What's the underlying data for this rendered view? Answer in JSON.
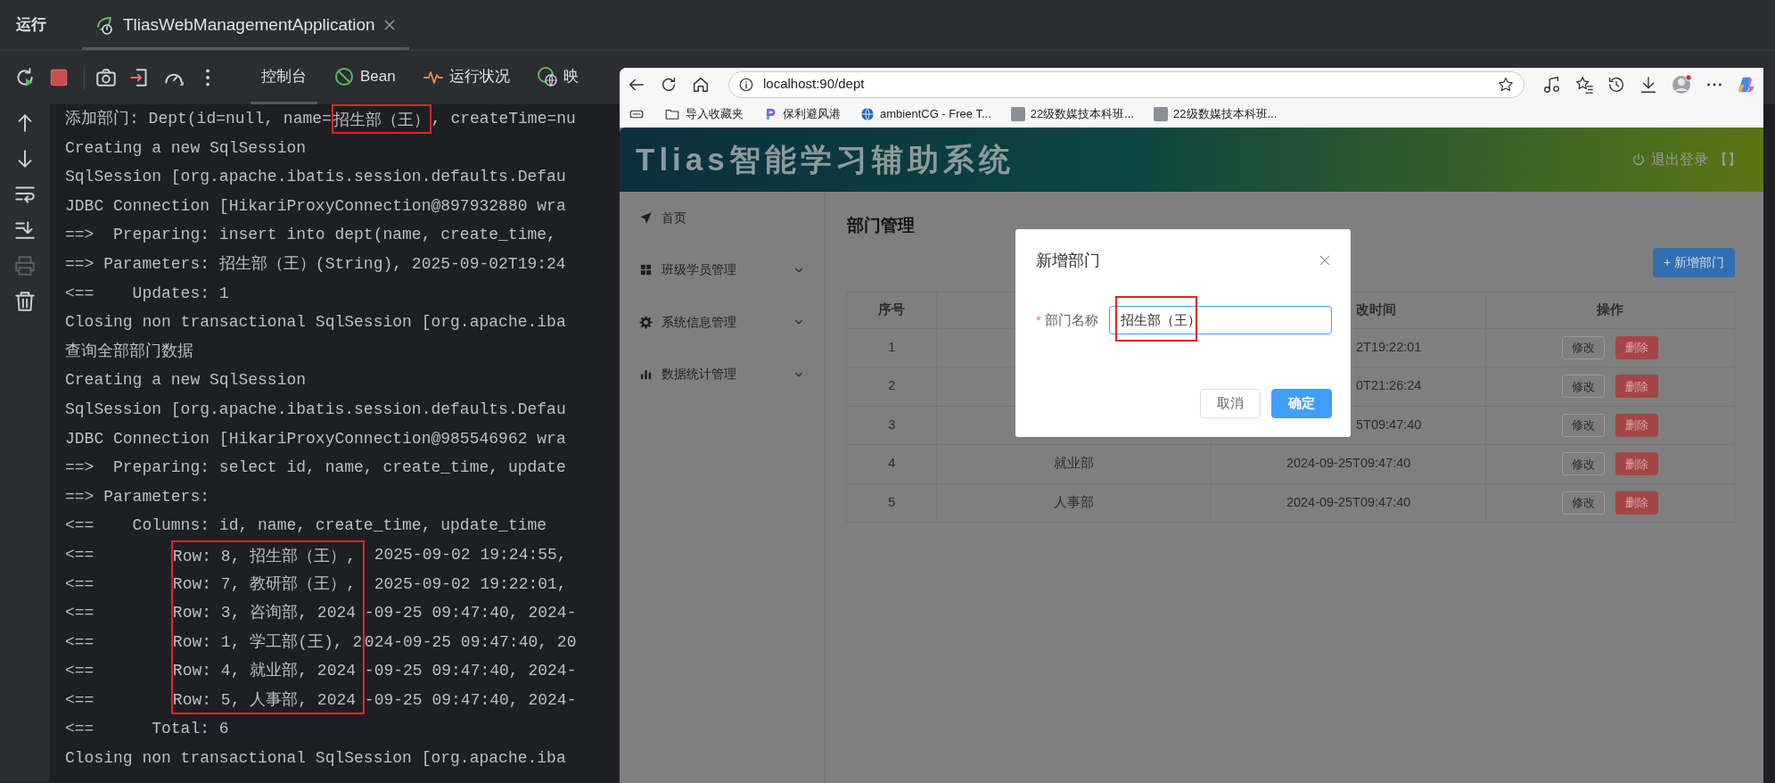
{
  "ide": {
    "title": "运行",
    "run_tab": {
      "label": "TliasWebManagementApplication",
      "selected": true
    },
    "tool_tabs": [
      {
        "label": "控制台",
        "selected": true
      },
      {
        "label": "Bean",
        "selected": false
      },
      {
        "label": "运行状况",
        "selected": false
      },
      {
        "label": "映",
        "selected": false
      }
    ],
    "gutter": [
      {
        "kind": "up",
        "disabled": false
      },
      {
        "kind": "down",
        "disabled": false
      },
      {
        "kind": "wrap",
        "disabled": false
      },
      {
        "kind": "scroll",
        "disabled": false
      },
      {
        "kind": "print",
        "disabled": true
      },
      {
        "kind": "trash",
        "disabled": false
      }
    ],
    "console": {
      "lines": [
        {
          "parts": [
            {
              "text": "添加部门: Dept(id=null, name=",
              "boxed": false
            },
            {
              "text": "招生部（王）",
              "boxed": true
            },
            {
              "text": ", createTime=nu",
              "boxed": false
            }
          ]
        },
        {
          "text": "Creating a new SqlSession"
        },
        {
          "text": "SqlSession [org.apache.ibatis.session.defaults.Defau"
        },
        {
          "text": "JDBC Connection [HikariProxyConnection@897932880 wra"
        },
        {
          "text": "==>  Preparing: insert into dept(name, create_time,"
        },
        {
          "text": "==> Parameters: 招生部（王）(String), 2025-09-02T19:24"
        },
        {
          "text": "<==    Updates: 1"
        },
        {
          "text": "Closing non transactional SqlSession [org.apache.iba"
        },
        {
          "text": "查询全部部门数据"
        },
        {
          "text": "Creating a new SqlSession"
        },
        {
          "text": "SqlSession [org.apache.ibatis.session.defaults.Defau"
        },
        {
          "text": "JDBC Connection [HikariProxyConnection@985546962 wra"
        },
        {
          "text": "==>  Preparing: select id, name, create_time, update"
        },
        {
          "text": "==> Parameters:"
        },
        {
          "text": "<==    Columns: id, name, create_time, update_time"
        },
        {
          "parts": [
            {
              "text": "<==        ",
              "boxed": false
            },
            {
              "text": "Row: 8, 招生部（王）,",
              "boxed": true
            },
            {
              "text": " 2025-09-02 19:24:55,",
              "boxed": false
            }
          ]
        },
        {
          "parts": [
            {
              "text": "<==        ",
              "boxed": false
            },
            {
              "text": "Row: 7, 教研部（王）,",
              "boxed": true
            },
            {
              "text": " 2025-09-02 19:22:01,",
              "boxed": false
            }
          ]
        },
        {
          "parts": [
            {
              "text": "<==        ",
              "boxed": false
            },
            {
              "text": "Row: 3, 咨询部, 2024",
              "boxed": true
            },
            {
              "text": "-09-25 09:47:40, 2024-",
              "boxed": false
            }
          ]
        },
        {
          "parts": [
            {
              "text": "<==        ",
              "boxed": false
            },
            {
              "text": "Row: 1, 学工部(王), 2",
              "boxed": true
            },
            {
              "text": "024-09-25 09:47:40, 20",
              "boxed": false
            }
          ]
        },
        {
          "parts": [
            {
              "text": "<==        ",
              "boxed": false
            },
            {
              "text": "Row: 4, 就业部, 2024",
              "boxed": true
            },
            {
              "text": "-09-25 09:47:40, 2024-",
              "boxed": false
            }
          ]
        },
        {
          "parts": [
            {
              "text": "<==        ",
              "boxed": false
            },
            {
              "text": "Row: 5, 人事部, 2024",
              "boxed": true
            },
            {
              "text": "-09-25 09:47:40, 2024-",
              "boxed": false
            }
          ]
        },
        {
          "text": "<==      Total: 6"
        },
        {
          "text": "Closing non transactional SqlSession [org.apache.iba"
        }
      ]
    }
  },
  "browser": {
    "address": "localhost:90/dept",
    "profile_notification": true,
    "bookmarks": [
      {
        "kind": "folder",
        "label": "导入收藏夹"
      },
      {
        "kind": "brand",
        "label": "保利避风港"
      },
      {
        "kind": "globe",
        "label": "ambientCG - Free T..."
      },
      {
        "kind": "photo",
        "label": "22级数媒技本科班..."
      },
      {
        "kind": "photo",
        "label": "22级数媒技本科班..."
      }
    ]
  },
  "app": {
    "title": "Tlias智能学习辅助系统",
    "logout": "退出登录",
    "logout_extra": "【】",
    "menu": [
      {
        "label": "首页",
        "kind": "link"
      },
      {
        "label": "班级学员管理",
        "kind": "submenu",
        "expanded": false
      },
      {
        "label": "系统信息管理",
        "kind": "submenu",
        "expanded": false
      },
      {
        "label": "数据统计管理",
        "kind": "submenu",
        "expanded": false
      }
    ],
    "page_title": "部门管理",
    "add_button": "+ 新增部门",
    "table": {
      "columns": {
        "number": "序号",
        "time": "改时间",
        "actions": "操作"
      },
      "rows": [
        {
          "number": "1",
          "time": "2T19:22:01",
          "edit": "修改",
          "delete": "删除"
        },
        {
          "number": "2",
          "time": "0T21:26:24",
          "edit": "修改",
          "delete": "删除"
        },
        {
          "number": "3",
          "time": "5T09:47:40",
          "edit": "修改",
          "delete": "删除"
        },
        {
          "number": "4",
          "name": "就业部",
          "time": "2024-09-25T09:47:40",
          "edit": "修改",
          "delete": "删除"
        },
        {
          "number": "5",
          "name": "人事部",
          "time": "2024-09-25T09:47:40",
          "edit": "修改",
          "delete": "删除"
        }
      ]
    },
    "dialog": {
      "title": "新增部门",
      "field": {
        "label": "部门名称",
        "required": true,
        "required_mark": "*",
        "value": "招生部（王）",
        "highlighted": true
      },
      "buttons": [
        {
          "label": "取消",
          "kind": "secondary"
        },
        {
          "label": "确定",
          "kind": "primary"
        }
      ]
    }
  }
}
